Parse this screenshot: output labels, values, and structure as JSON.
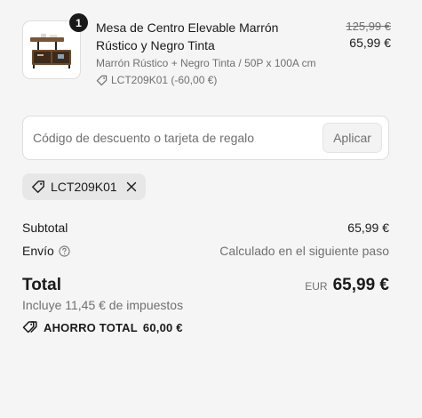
{
  "product": {
    "quantity": "1",
    "name": "Mesa de Centro Elevable Marrón Rústico y Negro Tinta",
    "variant": "Marrón Rústico + Negro Tinta / 50P x 100A cm",
    "discount_code_line": "LCT209K01 (-60,00 €)",
    "original_price": "125,99 €",
    "price": "65,99 €",
    "image_icon": "coffee-table-product-image"
  },
  "discount_field": {
    "placeholder": "Código de descuento o tarjeta de regalo",
    "value": "",
    "apply_label": "Aplicar"
  },
  "applied_code": {
    "code": "LCT209K01",
    "icon": "tag-icon",
    "remove_icon": "close-icon"
  },
  "summary": {
    "subtotal_label": "Subtotal",
    "subtotal_value": "65,99 €",
    "shipping_label": "Envío",
    "shipping_value": "Calculado en el siguiente paso",
    "total_label": "Total",
    "currency": "EUR",
    "total_value": "65,99 €",
    "taxes_note": "Incluye 11,45 € de impuestos",
    "savings_label": "AHORRO TOTAL",
    "savings_value": "60,00 €"
  },
  "colors": {
    "background": "#f5f5f5",
    "text": "#1a1a1a",
    "muted": "#707070",
    "chip": "#e7e7e7"
  }
}
